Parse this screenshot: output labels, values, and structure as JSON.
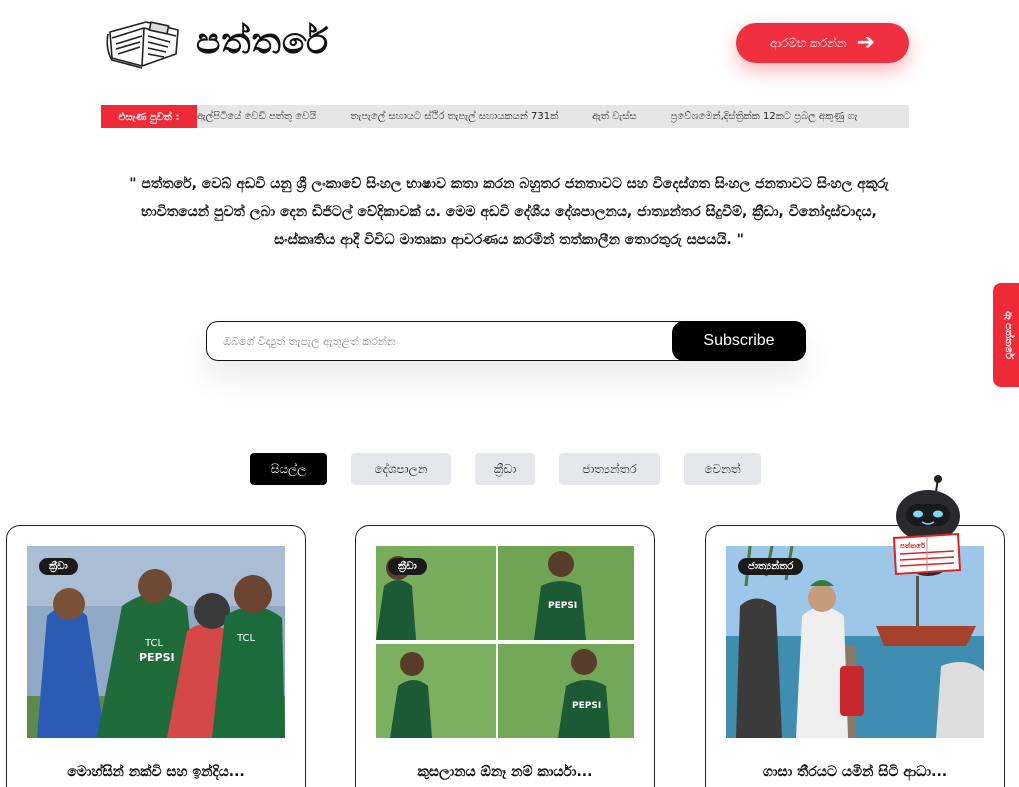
{
  "header": {
    "logo_text": "පත්තරේ",
    "start_button": "ආරම්භ කරන්න"
  },
  "ticker": {
    "label": "එසැණ පුවත් :",
    "items": [
      "ඇල්පිටියේ වෙඩි පත්තු වෙයි",
      "තැපැලේ සහායට ස්ථිර තැපැල් සහායකයන් 731ක්",
      "ඇත් වැස්ස",
      "ප්‍රවේශමෙන්,දිස්ත්‍රික්ක 12කට ප්‍රබල අකුණු ගැ"
    ]
  },
  "intro": {
    "text": "\" පත්තරේ, වෙබ් අඩවි යනු ශ්‍රී ලංකාවේ සිංහල භාෂාව කතා කරන බහුතර ජනතාවට සහ විදෙස්ගත සිංහල ජනතාවට සිංහල අකුරු භාවිතයෙන් පුවත් ලබා දෙන ඩිජිටල් වේදිකාවක් ය. මෙම අඩවි දේශීය දේශපාලනය, ජාත්‍යන්තර සිදුවීම්, ක්‍රීඩා, විනෝදාස්වාදය, සංස්කෘතිය ආදී විවිධ මාතෘකා ආවරණය කරමින් තත්කාලීන තොරතුරු සපයයි. \""
  },
  "subscribe": {
    "placeholder": "ඔබගේ විද්‍යුත් තැපැල ඇතුළත් කරන්න",
    "button": "Subscribe"
  },
  "side_tab": {
    "label": "ඈ පත්තරේ"
  },
  "filters": [
    {
      "label": "සියල්ල",
      "active": true
    },
    {
      "label": "දේශපාලන",
      "active": false
    },
    {
      "label": "ක්‍රීඩා",
      "active": false
    },
    {
      "label": "ජාත්‍යන්තර",
      "active": false
    },
    {
      "label": "වෙනත්",
      "active": false
    }
  ],
  "cards": [
    {
      "badge": "ක්‍රීඩා",
      "title": "මොහ්සින් නක්වි සහ ඉන්දිය..."
    },
    {
      "badge": "ක්‍රීඩා",
      "title": "කුසලානය ඕනෑ නම් කාර්යා..."
    },
    {
      "badge": "ජාත්‍යන්තර",
      "title": "ගාසා තීරයට යමින් සිටි ආධා..."
    }
  ],
  "robot_sign": "පත්තරේ",
  "colors": {
    "accent_red": "#ee2a36",
    "black": "#000000",
    "filter_bg": "#e5e7eb"
  }
}
